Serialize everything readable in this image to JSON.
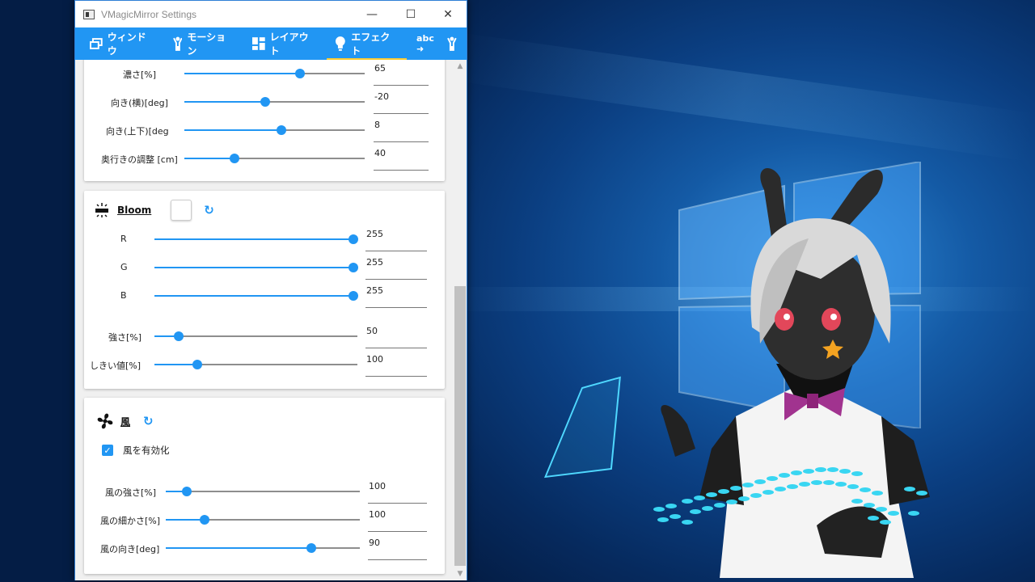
{
  "window": {
    "title": "VMagicMirror Settings",
    "minimize": "—",
    "maximize": "☐",
    "close": "✕"
  },
  "tabs": [
    {
      "label": "ウィンドウ",
      "icon": "window-icon"
    },
    {
      "label": "モーション",
      "icon": "person-icon"
    },
    {
      "label": "レイアウト",
      "icon": "layout-icon"
    },
    {
      "label": "エフェクト",
      "icon": "lightbulb-icon",
      "active": true
    },
    {
      "label": "abc ➜",
      "icon": "word-to-motion-icon"
    }
  ],
  "light_section": {
    "sliders": [
      {
        "label": "濃さ[%]",
        "value": "65",
        "fraction": 0.64
      },
      {
        "label": "向き(横)[deg]",
        "value": "-20",
        "fraction": 0.45
      },
      {
        "label": "向き(上下)[deg",
        "value": "8",
        "fraction": 0.54
      },
      {
        "label": "奥行きの調整 [cm]",
        "value": "40",
        "fraction": 0.28
      }
    ]
  },
  "bloom": {
    "title": "Bloom",
    "reset": "↻",
    "sliders": [
      {
        "label": "R",
        "value": "255",
        "fraction": 1.0
      },
      {
        "label": "G",
        "value": "255",
        "fraction": 1.0
      },
      {
        "label": "B",
        "value": "255",
        "fraction": 1.0
      },
      {
        "label": "強さ[%]",
        "value": "50",
        "fraction": 0.12
      },
      {
        "label": "しきい値[%]",
        "value": "100",
        "fraction": 0.21
      }
    ]
  },
  "wind": {
    "title": "風",
    "reset": "↻",
    "enable_label": "風を有効化",
    "enable_checked": true,
    "check_mark": "✓",
    "sliders": [
      {
        "label": "風の強さ[%]",
        "value": "100",
        "fraction": 0.11
      },
      {
        "label": "風の細かさ[%]",
        "value": "100",
        "fraction": 0.2
      },
      {
        "label": "風の向き[deg]",
        "value": "90",
        "fraction": 0.75
      }
    ]
  },
  "scrollbar": {
    "up": "▲",
    "down": "▼",
    "position": 0.6
  },
  "colors": {
    "accent": "#2196f3",
    "tab_underline": "#ffcc33"
  }
}
